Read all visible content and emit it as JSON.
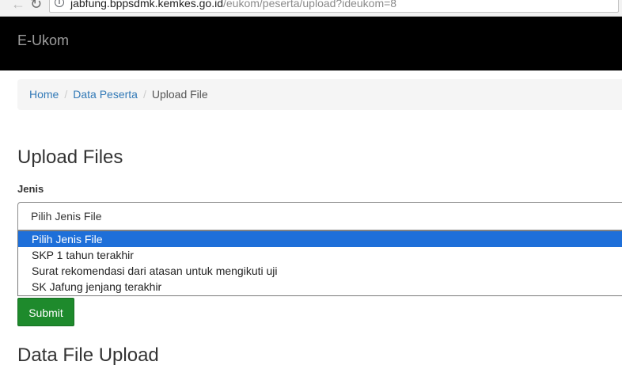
{
  "browser": {
    "back_icon": "arrow-left-icon",
    "reload_icon": "reload-icon",
    "url_host": "jabfung.bppsdmk.kemkes.go.id",
    "url_path": "/eukom/peserta/upload?ideukom=8"
  },
  "navbar": {
    "brand": "E-Ukom",
    "background": "#000000"
  },
  "breadcrumb": {
    "items": [
      {
        "label": "Home"
      },
      {
        "label": "Data Peserta"
      },
      {
        "label": "Upload File"
      }
    ],
    "separator": "/"
  },
  "upload": {
    "heading": "Upload Files",
    "jenis_label": "Jenis",
    "select_value": "Pilih Jenis File",
    "options": [
      "Pilih Jenis File",
      "SKP 1 tahun terakhir",
      "Surat rekomendasi dari atasan untuk mengikuti uji",
      "SK Jafung jenjang terakhir"
    ],
    "selected_option": "Pilih Jenis File",
    "submit_label": "Submit",
    "submit_color": "#1e8a2c"
  },
  "data_section": {
    "heading": "Data File Upload"
  }
}
